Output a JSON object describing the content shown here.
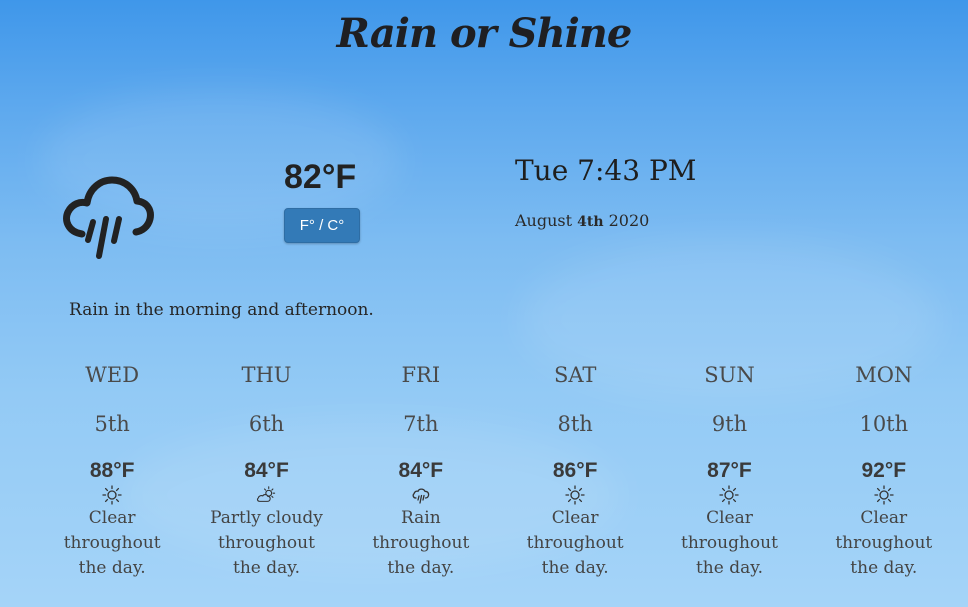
{
  "app": {
    "title": "Rain or Shine"
  },
  "current": {
    "icon": "rain-icon",
    "temperature": "82°F",
    "unit_toggle_label": "F° / C°",
    "datetime": "Tue 7:43 PM",
    "date_month": "August",
    "date_day": "4th",
    "date_year": "2020",
    "summary": "Rain in the morning and afternoon."
  },
  "forecast": [
    {
      "day": "WED",
      "date": "5th",
      "temp": "88°F",
      "icon": "sun-icon",
      "desc": "Clear throughout the day."
    },
    {
      "day": "THU",
      "date": "6th",
      "temp": "84°F",
      "icon": "partly-cloudy-icon",
      "desc": "Partly cloudy throughout the day."
    },
    {
      "day": "FRI",
      "date": "7th",
      "temp": "84°F",
      "icon": "rain-icon",
      "desc": "Rain throughout the day."
    },
    {
      "day": "SAT",
      "date": "8th",
      "temp": "86°F",
      "icon": "sun-icon",
      "desc": "Clear throughout the day."
    },
    {
      "day": "SUN",
      "date": "9th",
      "temp": "87°F",
      "icon": "sun-icon",
      "desc": "Clear throughout the day."
    },
    {
      "day": "MON",
      "date": "10th",
      "temp": "92°F",
      "icon": "sun-icon",
      "desc": "Clear throughout the day."
    }
  ],
  "colors": {
    "toggle_button": "#337ab7",
    "icon_dark": "#222222"
  }
}
